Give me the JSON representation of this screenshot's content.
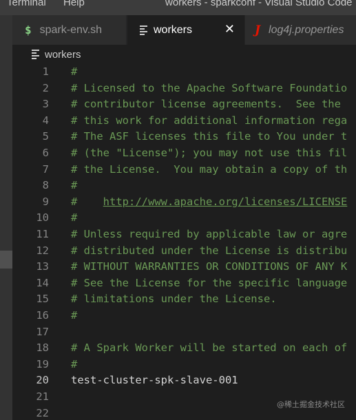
{
  "menubar": {
    "items": [
      "Terminal",
      "Help"
    ],
    "window_title": "workers - sparkconf - Visual Studio Code"
  },
  "tabs": [
    {
      "label": "spark-env.sh",
      "icon": "dollar-icon",
      "active": false
    },
    {
      "label": "workers",
      "icon": "lines-icon",
      "active": true,
      "close": "✕"
    },
    {
      "label": "log4j.properties",
      "icon": "j-icon",
      "active": false
    }
  ],
  "breadcrumb": {
    "label": "workers"
  },
  "editor": {
    "lines": [
      {
        "num": "1",
        "text": "#"
      },
      {
        "num": "2",
        "text": "# Licensed to the Apache Software Foundatio"
      },
      {
        "num": "3",
        "text": "# contributor license agreements.  See the "
      },
      {
        "num": "4",
        "text": "# this work for additional information rega"
      },
      {
        "num": "5",
        "text": "# The ASF licenses this file to You under t"
      },
      {
        "num": "6",
        "text": "# (the \"License\"); you may not use this fil"
      },
      {
        "num": "7",
        "text": "# the License.  You may obtain a copy of th"
      },
      {
        "num": "8",
        "text": "#"
      },
      {
        "num": "9",
        "text": "#    ",
        "url": "http://www.apache.org/licenses/LICENSE"
      },
      {
        "num": "10",
        "text": "#"
      },
      {
        "num": "11",
        "text": "# Unless required by applicable law or agre"
      },
      {
        "num": "12",
        "text": "# distributed under the License is distribu"
      },
      {
        "num": "13",
        "text": "# WITHOUT WARRANTIES OR CONDITIONS OF ANY K"
      },
      {
        "num": "14",
        "text": "# See the License for the specific language"
      },
      {
        "num": "15",
        "text": "# limitations under the License."
      },
      {
        "num": "16",
        "text": "#"
      },
      {
        "num": "17",
        "text": ""
      },
      {
        "num": "18",
        "text": "# A Spark Worker will be started on each of"
      },
      {
        "num": "19",
        "text": "#"
      },
      {
        "num": "20",
        "text": "test-cluster-spk-slave-001",
        "plain": true,
        "current": true
      },
      {
        "num": "21",
        "text": ""
      },
      {
        "num": "22",
        "text": ""
      }
    ]
  },
  "watermark": "@稀土掘金技术社区",
  "colors": {
    "comment": "#6a9955",
    "text": "#d4d4d4",
    "background": "#1e1e1e"
  }
}
